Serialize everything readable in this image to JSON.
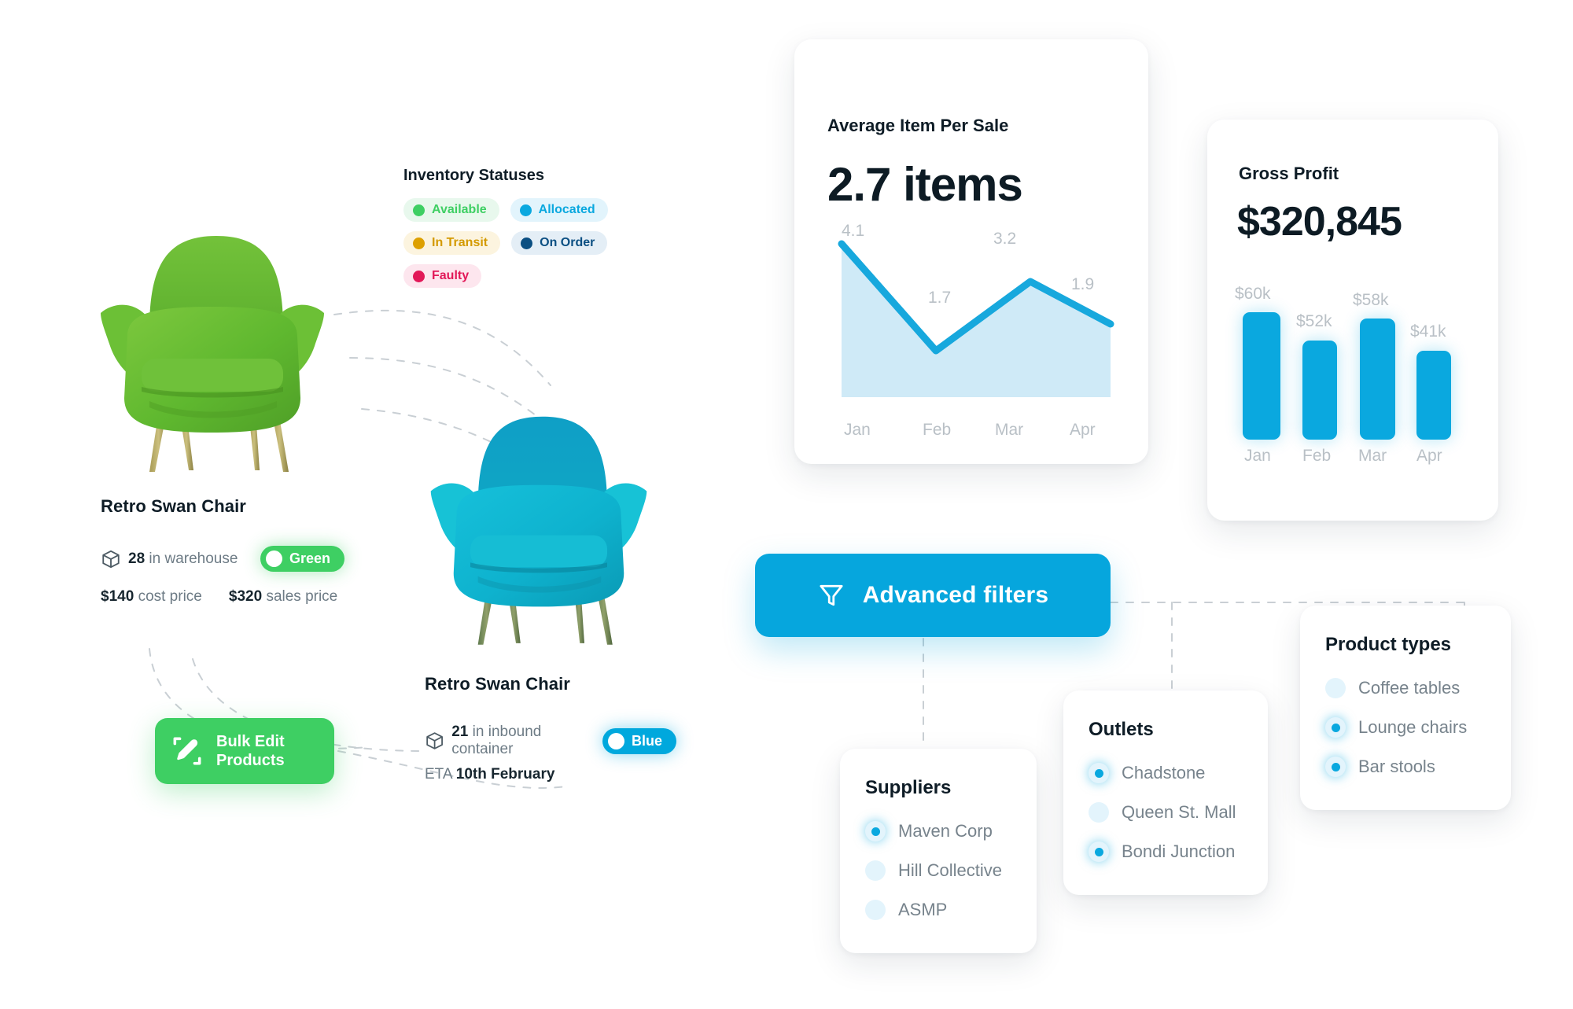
{
  "products": [
    {
      "name": "Retro Swan Chair",
      "stock_count": "28",
      "stock_label": "in warehouse",
      "variant": "Green",
      "cost_price": "$140",
      "cost_label": "cost price",
      "sales_price": "$320",
      "sales_label": "sales price",
      "color_hex": "#56b633",
      "pkg_icon": "package-icon"
    },
    {
      "name": "Retro Swan Chair",
      "stock_count": "21",
      "stock_label": "in inbound container",
      "variant": "Blue",
      "eta_label": "ETA",
      "eta_value": "10th February",
      "color_hex": "#0aa3c2",
      "pkg_icon": "package-icon"
    }
  ],
  "inventory": {
    "title": "Inventory Statuses",
    "statuses": [
      {
        "label": "Available",
        "dot": "#3ecf63",
        "text": "#3ecf63",
        "bg": "#e8f8ed"
      },
      {
        "label": "Allocated",
        "dot": "#0aa8df",
        "text": "#0aa8df",
        "bg": "#e2f4fc"
      },
      {
        "label": "In Transit",
        "dot": "#dda000",
        "text": "#d49a00",
        "bg": "#fcf4df"
      },
      {
        "label": "On Order",
        "dot": "#0b4f82",
        "text": "#0b4f82",
        "bg": "#e4eef6"
      },
      {
        "label": "Faulty",
        "dot": "#e21858",
        "text": "#e21858",
        "bg": "#fde6ee"
      }
    ]
  },
  "bulk_edit": {
    "line1": "Bulk Edit",
    "line2": "Products",
    "icon": "edit-pencil-icon",
    "color": "#3ecf63"
  },
  "advanced_filters": {
    "label": "Advanced filters",
    "icon": "funnel-icon",
    "color": "#06a6dd"
  },
  "filter_groups": [
    {
      "title": "Suppliers",
      "options": [
        {
          "label": "Maven Corp",
          "selected": true
        },
        {
          "label": "Hill Collective",
          "selected": false
        },
        {
          "label": "ASMP",
          "selected": false
        }
      ]
    },
    {
      "title": "Outlets",
      "options": [
        {
          "label": "Chadstone",
          "selected": true
        },
        {
          "label": "Queen St. Mall",
          "selected": false
        },
        {
          "label": "Bondi Junction",
          "selected": true
        }
      ]
    },
    {
      "title": "Product types",
      "options": [
        {
          "label": "Coffee tables",
          "selected": false
        },
        {
          "label": "Lounge chairs",
          "selected": true
        },
        {
          "label": "Bar stools",
          "selected": true
        }
      ]
    }
  ],
  "chart_data": [
    {
      "type": "area",
      "title": "Average Item Per Sale",
      "headline": "2.7 items",
      "categories": [
        "Jan",
        "Feb",
        "Mar",
        "Apr"
      ],
      "values": [
        4.1,
        1.7,
        3.2,
        1.9
      ],
      "point_labels": [
        "4.1",
        "1.7",
        "3.2",
        "1.9"
      ],
      "xlabel": "",
      "ylabel": "",
      "ylim": [
        0,
        4.6
      ],
      "grid": false,
      "legend": "none",
      "line_color": "#17a8dd",
      "fill_color": "#cfeaf7"
    },
    {
      "type": "bar",
      "title": "Gross Profit",
      "headline": "$320,845",
      "categories": [
        "Jan",
        "Feb",
        "Mar",
        "Apr"
      ],
      "values": [
        60,
        52,
        58,
        41
      ],
      "value_labels": [
        "$60k",
        "$52k",
        "$58k",
        "$41k"
      ],
      "xlabel": "",
      "ylabel": "",
      "ylim": [
        0,
        68
      ],
      "grid": false,
      "legend": "none",
      "bar_color": "#0aa8df"
    }
  ]
}
